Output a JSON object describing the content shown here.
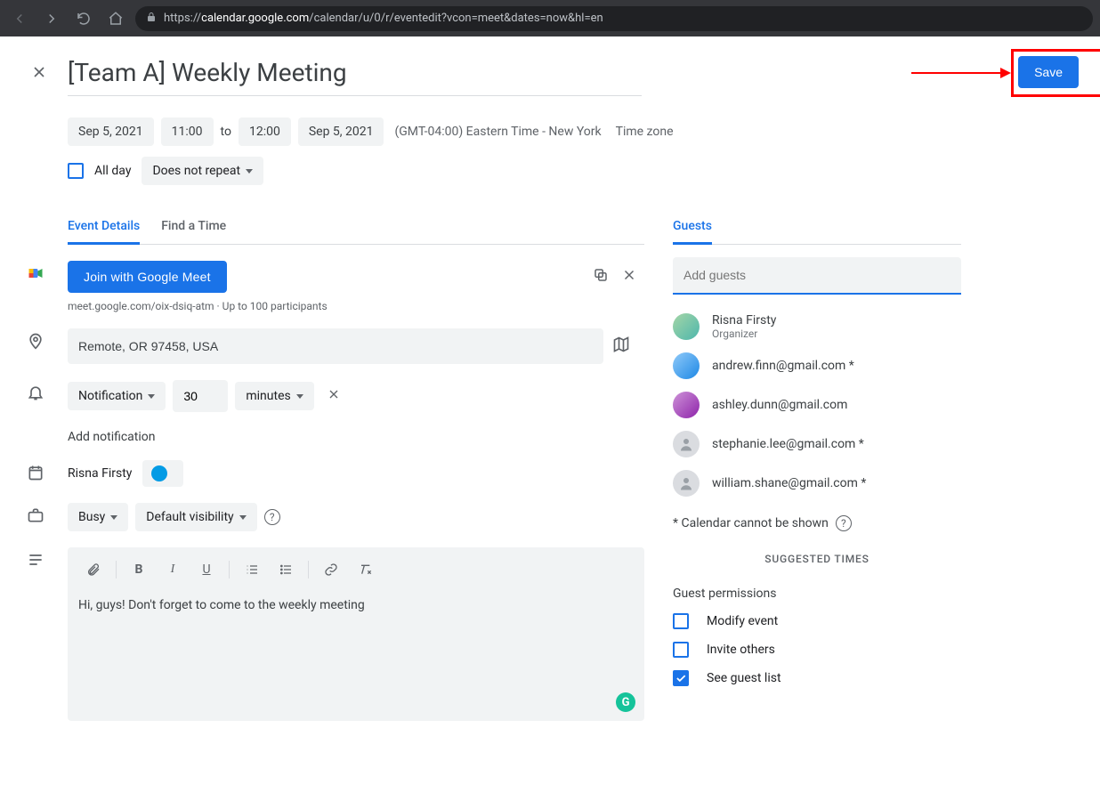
{
  "browser": {
    "url_prefix": "https://",
    "url_domain": "calendar.google.com",
    "url_path": "/calendar/u/0/r/eventedit?vcon=meet&dates=now&hl=en"
  },
  "header": {
    "title": "[Team A] Weekly Meeting",
    "save_label": "Save"
  },
  "time": {
    "start_date": "Sep 5, 2021",
    "start_time": "11:00",
    "to": "to",
    "end_time": "12:00",
    "end_date": "Sep 5, 2021",
    "tz_label": "(GMT-04:00) Eastern Time - New York",
    "tz_link": "Time zone",
    "all_day": "All day",
    "recurrence": "Does not repeat"
  },
  "tabs": {
    "event_details": "Event Details",
    "find_time": "Find a Time"
  },
  "meet": {
    "join_label": "Join with Google Meet",
    "sub": "meet.google.com/oix-dsiq-atm · Up to 100 participants"
  },
  "location": {
    "value": "Remote, OR 97458, USA"
  },
  "notification": {
    "type": "Notification",
    "value": "30",
    "unit": "minutes",
    "add_label": "Add notification"
  },
  "calendar": {
    "owner": "Risna Firsty",
    "color": "#039be5"
  },
  "availability": {
    "busy": "Busy",
    "visibility": "Default visibility"
  },
  "description": "Hi, guys! Don't forget to come to the weekly meeting",
  "guests": {
    "tab": "Guests",
    "placeholder": "Add guests",
    "list": [
      {
        "name": "Risna Firsty",
        "role": "Organizer",
        "img": true,
        "bg": "linear-gradient(135deg,#a5d6a7,#4db6ac)"
      },
      {
        "name": "andrew.finn@gmail.com *",
        "img": true,
        "bg": "linear-gradient(135deg,#90caf9,#1e88e5)"
      },
      {
        "name": "ashley.dunn@gmail.com",
        "img": true,
        "bg": "linear-gradient(135deg,#ce93d8,#8e24aa)"
      },
      {
        "name": "stephanie.lee@gmail.com *",
        "img": false
      },
      {
        "name": "william.shane@gmail.com *",
        "img": false
      }
    ],
    "warn": "* Calendar cannot be shown",
    "suggested": "SUGGESTED TIMES",
    "perms_title": "Guest permissions",
    "perms": [
      {
        "label": "Modify event",
        "checked": false
      },
      {
        "label": "Invite others",
        "checked": false
      },
      {
        "label": "See guest list",
        "checked": true
      }
    ]
  }
}
